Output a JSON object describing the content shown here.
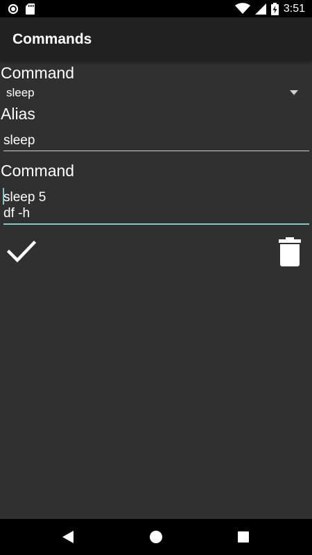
{
  "status_bar": {
    "time": "3:51",
    "icons": [
      "circle-notification-icon",
      "sd-card-icon",
      "wifi-icon",
      "signal-icon",
      "battery-charging-icon"
    ]
  },
  "app_bar": {
    "title": "Commands"
  },
  "form": {
    "command_label": "Command",
    "command_selected": "sleep",
    "alias_label": "Alias",
    "alias_value": "sleep",
    "script_label": "Command",
    "script_lines": [
      "sleep 5",
      "df -h"
    ]
  },
  "actions": {
    "confirm_icon": "check-icon",
    "delete_icon": "trash-icon"
  },
  "nav_bar": {
    "icons": [
      "back-icon",
      "home-icon",
      "recents-icon"
    ]
  },
  "colors": {
    "background": "#303030",
    "app_bar": "#212121",
    "accent": "#80cbc4",
    "text": "#ffffff"
  }
}
